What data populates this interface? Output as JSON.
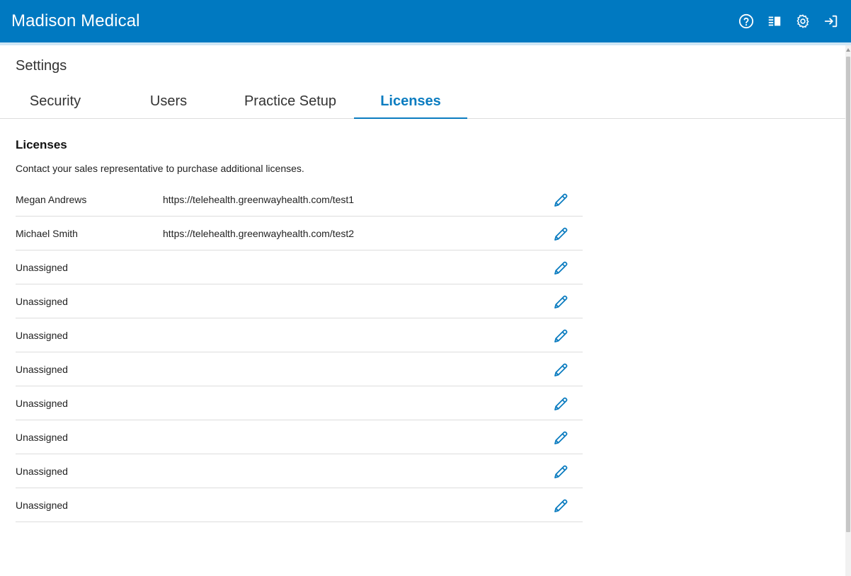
{
  "header": {
    "title": "Madison Medical",
    "icons": [
      "help-icon",
      "columns-icon",
      "gear-icon",
      "sign-out-icon"
    ],
    "accent_color": "#0079c1"
  },
  "page": {
    "title": "Settings"
  },
  "tabs": [
    {
      "label": "Security",
      "active": false
    },
    {
      "label": "Users",
      "active": false
    },
    {
      "label": "Practice Setup",
      "active": false
    },
    {
      "label": "Licenses",
      "active": true
    }
  ],
  "licenses": {
    "title": "Licenses",
    "note": "Contact your sales representative to purchase additional licenses.",
    "rows": [
      {
        "name": "Megan Andrews",
        "url": "https://telehealth.greenwayhealth.com/test1"
      },
      {
        "name": "Michael Smith",
        "url": "https://telehealth.greenwayhealth.com/test2"
      },
      {
        "name": "Unassigned",
        "url": ""
      },
      {
        "name": "Unassigned",
        "url": ""
      },
      {
        "name": "Unassigned",
        "url": ""
      },
      {
        "name": "Unassigned",
        "url": ""
      },
      {
        "name": "Unassigned",
        "url": ""
      },
      {
        "name": "Unassigned",
        "url": ""
      },
      {
        "name": "Unassigned",
        "url": ""
      },
      {
        "name": "Unassigned",
        "url": ""
      }
    ],
    "edit_icon": "pencil-icon",
    "icon_color": "#0b7cc0"
  }
}
